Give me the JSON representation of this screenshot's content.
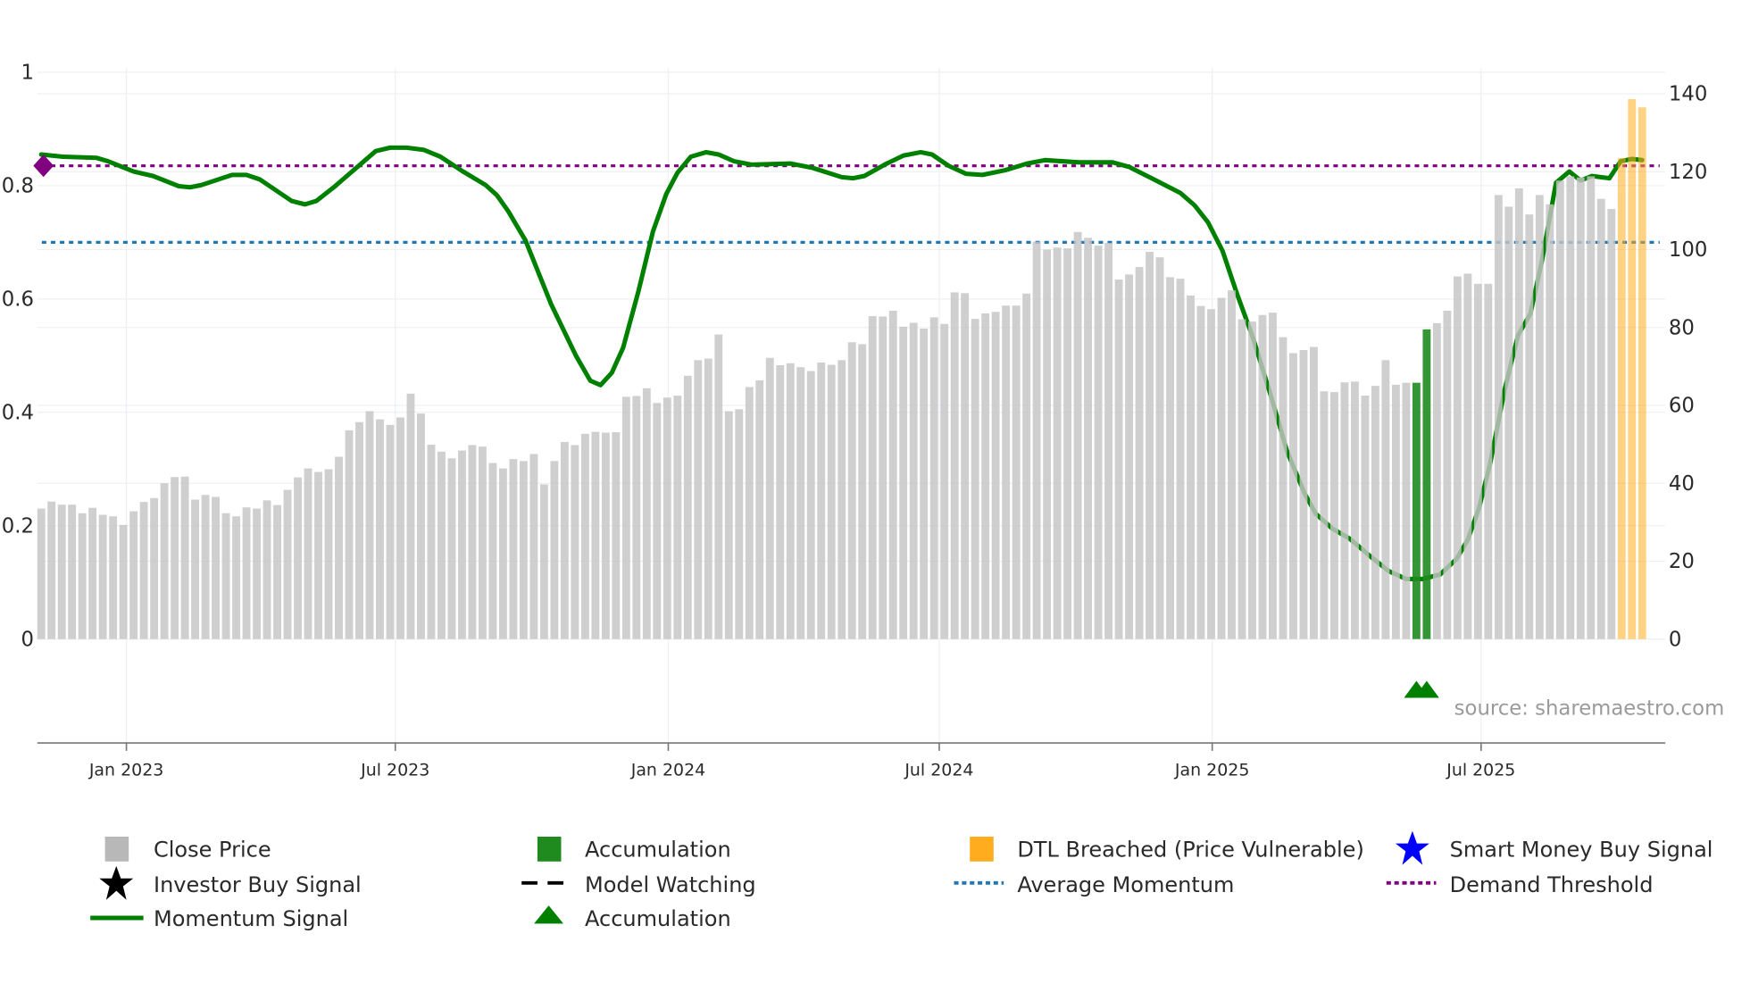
{
  "chart_data": {
    "type": "bar",
    "title": "",
    "source": "source: sharemaestro.com",
    "x_axis": {
      "ticks": [
        {
          "label": "Jan 2023",
          "week_index": 8.3
        },
        {
          "label": "Jul 2023",
          "week_index": 34.5
        },
        {
          "label": "Jan 2024",
          "week_index": 61.1
        },
        {
          "label": "Jul 2024",
          "week_index": 87.5
        },
        {
          "label": "Jan 2025",
          "week_index": 114.1
        },
        {
          "label": "Jul 2025",
          "week_index": 140.3
        }
      ]
    },
    "y_left": {
      "range": [
        -0.18,
        1
      ],
      "ticks": [
        "0",
        "0.2",
        "0.4",
        "0.6",
        "0.8",
        "1"
      ],
      "tick_values": [
        0,
        0.2,
        0.4,
        0.6,
        0.8,
        1
      ]
    },
    "y_right": {
      "range": [
        0,
        140
      ],
      "ticks": [
        "0",
        "20",
        "40",
        "60",
        "80",
        "100",
        "120",
        "140"
      ],
      "tick_values": [
        0,
        20,
        40,
        60,
        80,
        100,
        120,
        140
      ]
    },
    "close_price": [
      33.5,
      35.3,
      34.5,
      34.5,
      32.3,
      33.7,
      31.9,
      31.5,
      29.3,
      32.8,
      35.2,
      36.2,
      40,
      41.6,
      41.7,
      35.8,
      37,
      36.5,
      32.3,
      31.5,
      33.8,
      33.5,
      35.6,
      34.4,
      38.3,
      41.5,
      43.8,
      42.9,
      43.6,
      46.8,
      53.6,
      55.7,
      58.5,
      56.4,
      55,
      56.9,
      63,
      57.9,
      49.9,
      48.1,
      46.4,
      48.4,
      49.8,
      49.4,
      45.2,
      43.8,
      46.2,
      45.7,
      47.5,
      39.7,
      45.7,
      50.6,
      49.8,
      52.7,
      53.2,
      53,
      53.1,
      62.2,
      62.4,
      64.4,
      60.6,
      62,
      62.5,
      67.6,
      71.6,
      72,
      78.2,
      58.5,
      59,
      64.7,
      66.4,
      72.2,
      70.3,
      70.8,
      69.8,
      68.8,
      71,
      70.4,
      71.6,
      76.2,
      75.7,
      82.9,
      82.8,
      84.3,
      80.2,
      81.2,
      79.7,
      82.6,
      80.9,
      89,
      88.8,
      82.2,
      83.6,
      84,
      85.6,
      85.6,
      88.7,
      102,
      100,
      100.5,
      100.3,
      104.5,
      103,
      101,
      101.7,
      92.3,
      93.6,
      95.5,
      99.4,
      98,
      92.9,
      92.5,
      88.2,
      85.5,
      84.7,
      87.6,
      89.5,
      82.1,
      81.5,
      83.2,
      83.8,
      77.5,
      73.4,
      74.2,
      75,
      63.6,
      63.4,
      65.9,
      66.1,
      62.5,
      65,
      71.6,
      65.3,
      65.8,
      65.8,
      79.5,
      81.1,
      84.3,
      93.1,
      93.8,
      91.2,
      91.2,
      114,
      111,
      115.7,
      109,
      114,
      111.6,
      117.7,
      118.8,
      118.5,
      118.8,
      113,
      110.4,
      123.5,
      138.6,
      136.5
    ],
    "accumulation_weeks": [
      134,
      135
    ],
    "dtl_breached_weeks": [
      154,
      155,
      156
    ],
    "accumulation_markers": [
      134,
      135
    ],
    "momentum_signal": [
      [
        0,
        0.855
      ],
      [
        2.1,
        0.851
      ],
      [
        5.4,
        0.849
      ],
      [
        6.5,
        0.843
      ],
      [
        9,
        0.825
      ],
      [
        10.9,
        0.817
      ],
      [
        13.4,
        0.799
      ],
      [
        14.5,
        0.797
      ],
      [
        15.6,
        0.801
      ],
      [
        18.6,
        0.819
      ],
      [
        20,
        0.819
      ],
      [
        21.3,
        0.811
      ],
      [
        24.4,
        0.773
      ],
      [
        25.7,
        0.767
      ],
      [
        26.8,
        0.773
      ],
      [
        28.5,
        0.797
      ],
      [
        31.2,
        0.839
      ],
      [
        32.6,
        0.861
      ],
      [
        34,
        0.867
      ],
      [
        35.6,
        0.867
      ],
      [
        37.3,
        0.863
      ],
      [
        38.9,
        0.851
      ],
      [
        41.1,
        0.825
      ],
      [
        43.3,
        0.801
      ],
      [
        44.4,
        0.783
      ],
      [
        45.5,
        0.755
      ],
      [
        47.2,
        0.703
      ],
      [
        49.7,
        0.59
      ],
      [
        52.1,
        0.5
      ],
      [
        53.5,
        0.456
      ],
      [
        54.5,
        0.448
      ],
      [
        55.6,
        0.47
      ],
      [
        56.7,
        0.514
      ],
      [
        58.2,
        0.614
      ],
      [
        59.6,
        0.719
      ],
      [
        60.9,
        0.785
      ],
      [
        62,
        0.823
      ],
      [
        63.3,
        0.851
      ],
      [
        64.8,
        0.859
      ],
      [
        66,
        0.855
      ],
      [
        67.5,
        0.843
      ],
      [
        69.2,
        0.837
      ],
      [
        73,
        0.839
      ],
      [
        75.2,
        0.831
      ],
      [
        78,
        0.815
      ],
      [
        79.1,
        0.813
      ],
      [
        80.2,
        0.817
      ],
      [
        82.4,
        0.839
      ],
      [
        84,
        0.853
      ],
      [
        85.7,
        0.859
      ],
      [
        86.8,
        0.855
      ],
      [
        88.4,
        0.835
      ],
      [
        90.1,
        0.821
      ],
      [
        91.7,
        0.819
      ],
      [
        93.9,
        0.827
      ],
      [
        96.1,
        0.839
      ],
      [
        97.8,
        0.845
      ],
      [
        101.1,
        0.841
      ],
      [
        104.4,
        0.841
      ],
      [
        106,
        0.833
      ],
      [
        108.2,
        0.813
      ],
      [
        111,
        0.787
      ],
      [
        112.4,
        0.765
      ],
      [
        113.7,
        0.735
      ],
      [
        115.1,
        0.685
      ],
      [
        116.5,
        0.61
      ],
      [
        118.1,
        0.53
      ],
      [
        119.8,
        0.43
      ],
      [
        121.4,
        0.331
      ],
      [
        123.1,
        0.257
      ],
      [
        124.2,
        0.221
      ],
      [
        125.8,
        0.195
      ],
      [
        127.5,
        0.177
      ],
      [
        129.7,
        0.143
      ],
      [
        131.3,
        0.12
      ],
      [
        133,
        0.106
      ],
      [
        134.6,
        0.106
      ],
      [
        136.3,
        0.114
      ],
      [
        137.9,
        0.141
      ],
      [
        139,
        0.175
      ],
      [
        140.1,
        0.231
      ],
      [
        141.2,
        0.311
      ],
      [
        142.6,
        0.44
      ],
      [
        143.9,
        0.536
      ],
      [
        145.1,
        0.574
      ],
      [
        146.2,
        0.665
      ],
      [
        147.6,
        0.805
      ],
      [
        148.9,
        0.825
      ],
      [
        150,
        0.809
      ],
      [
        151.1,
        0.817
      ],
      [
        152.8,
        0.813
      ],
      [
        153.9,
        0.843
      ],
      [
        155,
        0.847
      ],
      [
        156,
        0.845
      ]
    ],
    "average_momentum": 0.7,
    "demand_threshold": 0.835,
    "demand_marker_week": 0,
    "legend": {
      "placement": "bottom",
      "items": [
        {
          "label": "Close Price",
          "color": "#b8b8b8"
        },
        {
          "label": "Accumulation",
          "color": "#1f8b1f"
        },
        {
          "label": "DTL Breached (Price Vulnerable)",
          "color": "#ffad1f"
        },
        {
          "label": "Smart Money Buy Signal",
          "color": "#0000ff"
        },
        {
          "label": "Investor Buy Signal",
          "color": "#000000"
        },
        {
          "label": "Model Watching",
          "color": "#000000"
        },
        {
          "label": "Average Momentum",
          "color": "#1f77b4"
        },
        {
          "label": "Demand Threshold",
          "color": "#800080"
        },
        {
          "label": "Momentum Signal",
          "color": "#008000"
        },
        {
          "label": "Accumulation",
          "color": "#008000"
        }
      ]
    }
  }
}
